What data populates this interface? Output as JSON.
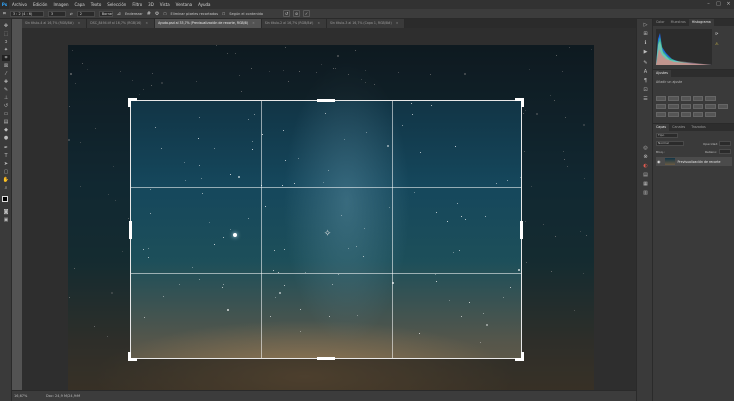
{
  "app": {
    "logo": "Ps"
  },
  "menu": [
    "Archivo",
    "Edición",
    "Imagen",
    "Capa",
    "Texto",
    "Selección",
    "Filtro",
    "3D",
    "Vista",
    "Ventana",
    "Ayuda"
  ],
  "window_controls": {
    "minimize": "–",
    "maximize": "□",
    "close": "×"
  },
  "options": {
    "tool_icon": "crop-icon",
    "ratio": "3 : 2 (4 : 6)",
    "width": "3",
    "swap": "⇄",
    "height": "2",
    "clear_label": "Borrar",
    "straighten_label": "Enderezar",
    "delete_cropped_label": "Eliminar píxeles recortados",
    "content_aware_label": "Según el contenido",
    "reset_icon": "↺",
    "cancel_icon": "⊘",
    "commit_icon": "✓"
  },
  "tabs": [
    {
      "label": "Sin título-4 al 16,7% (RGB/8#)",
      "close": "×"
    },
    {
      "label": "DSC_8494.tif al 16,7% (RGB/16)",
      "close": "×"
    },
    {
      "label": "Ayuda.psd al 33,7% (Previsualización de recorte, RGB/8)",
      "close": "×"
    },
    {
      "label": "Sin título-2 al 16,7% (RGB/8#)",
      "close": "×"
    },
    {
      "label": "Sin título-3 al 16,7% (Capa 1, RGB/8#)",
      "close": "×"
    }
  ],
  "tools": [
    "move-icon",
    "marquee-icon",
    "lasso-icon",
    "magic-wand-icon",
    "crop-icon",
    "frame-icon",
    "eyedropper-icon",
    "healing-icon",
    "brush-icon",
    "stamp-icon",
    "history-brush-icon",
    "eraser-icon",
    "gradient-icon",
    "blur-icon",
    "dodge-icon",
    "pen-icon",
    "type-icon",
    "path-select-icon",
    "rectangle-icon",
    "hand-icon",
    "zoom-icon",
    "more-icon"
  ],
  "status": {
    "zoom": "16,67%",
    "doc": "Doc: 24,9 M/24,9 M"
  },
  "panels": {
    "top_tabs": [
      "Color",
      "Muestras",
      "Histograma"
    ],
    "adjust_tabs": [
      "Ajustes"
    ],
    "adjust_hint": "Añadir un ajuste",
    "layer_tabs": [
      "Capas",
      "Canales",
      "Trazados"
    ],
    "layer_filter": "Tipo",
    "blend_mode": "Normal",
    "opacity_label": "Opacidad:",
    "fill_label": "Relleno:",
    "lock_label": "Bloq.:",
    "layer_name": "Previsualización de recorte"
  },
  "colors": {
    "accent": "#31a8ff",
    "workspace": "#535353",
    "panel": "#3a3a3a",
    "bar": "#323232"
  }
}
